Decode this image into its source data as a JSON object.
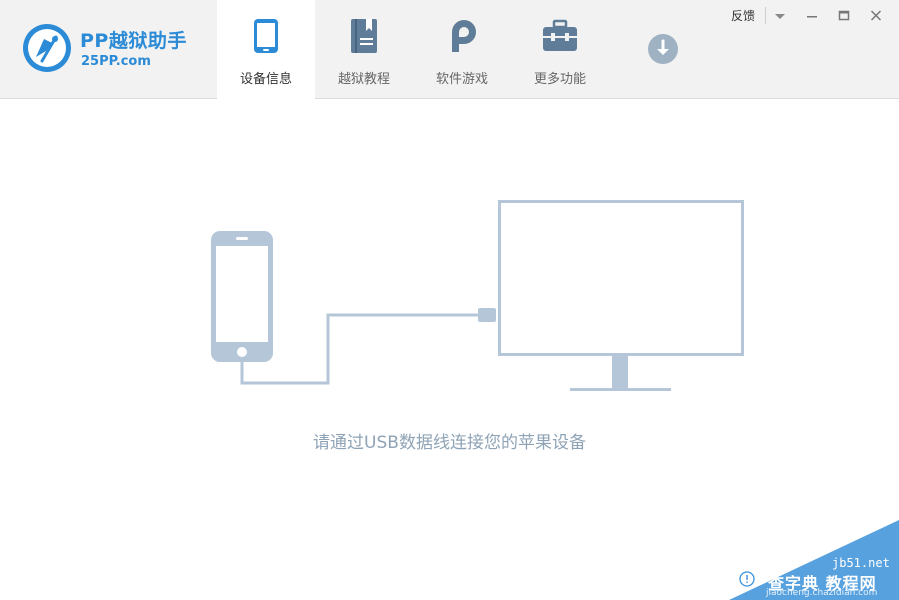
{
  "app": {
    "title": "PP越狱助手",
    "domain": "25PP.com"
  },
  "tabs": [
    {
      "label": "设备信息",
      "icon": "phone-icon",
      "active": true
    },
    {
      "label": "越狱教程",
      "icon": "book-icon",
      "active": false
    },
    {
      "label": "软件游戏",
      "icon": "pp-logo-icon",
      "active": false
    },
    {
      "label": "更多功能",
      "icon": "toolbox-icon",
      "active": false
    }
  ],
  "window_controls": {
    "feedback": "反馈",
    "menu_icon": "dropdown-icon",
    "minimize_icon": "minimize-icon",
    "maximize_icon": "maximize-icon",
    "close_icon": "close-icon"
  },
  "main": {
    "connect_hint": "请通过USB数据线连接您的苹果设备"
  },
  "watermark": {
    "site": "jb51.net",
    "name": "查字典 教程网",
    "url": "jiaocheng.chazidian.com"
  },
  "colors": {
    "brand": "#2c8bd6",
    "illustration": "#b4c6d8",
    "hint_text": "#8fa3b6",
    "tab_icon": "#5f7c99"
  }
}
